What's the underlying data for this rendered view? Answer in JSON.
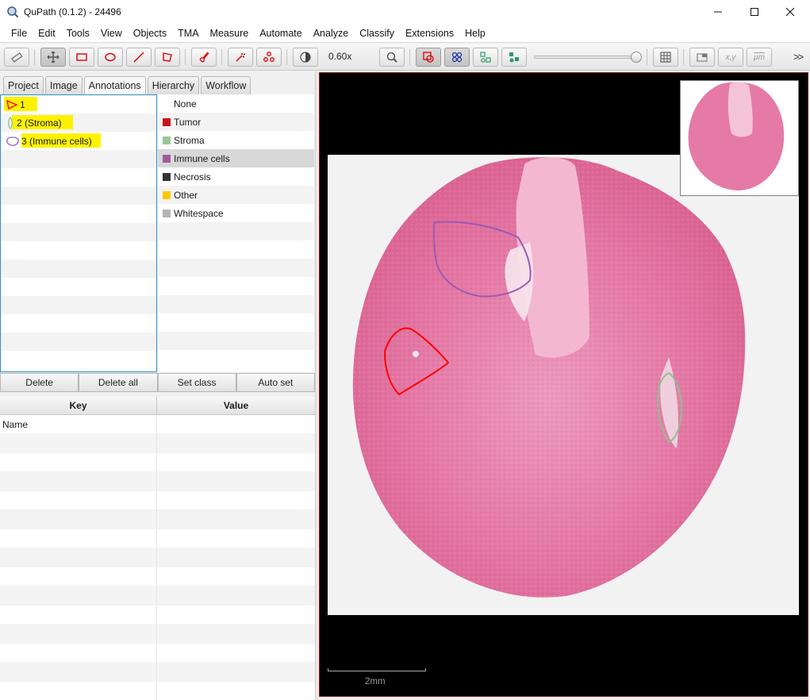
{
  "window": {
    "title": "QuPath (0.1.2) - 24496",
    "app_icon": "qupath-magnifier-icon",
    "controls": [
      "minimize-icon",
      "maximize-icon",
      "close-icon"
    ]
  },
  "menu": [
    "File",
    "Edit",
    "Tools",
    "View",
    "Objects",
    "TMA",
    "Measure",
    "Automate",
    "Analyze",
    "Classify",
    "Extensions",
    "Help"
  ],
  "toolbar": {
    "zoom_label": "0.60x",
    "coord_button": "x,y",
    "micron_button": "μm",
    "overflow": ">>",
    "active_tool": "move-tool",
    "icons": [
      "measurement-tool-icon",
      "move-icon",
      "rectangle-icon",
      "ellipse-icon",
      "line-icon",
      "polygon-icon",
      "brush-icon",
      "wand-icon",
      "points-icon",
      "brightness-contrast-icon",
      "zoom-to-fit-icon",
      "show-annotations-icon",
      "show-tma-grid-icon",
      "show-detections-icon",
      "fill-detections-icon",
      "opacity-slider",
      "grid-icon",
      "overview-icon",
      "location-icon",
      "scalebar-icon"
    ],
    "opacity_level": 0.95
  },
  "left_tabs": [
    "Project",
    "Image",
    "Annotations",
    "Hierarchy",
    "Workflow"
  ],
  "selected_tab": "Annotations",
  "annotations": [
    {
      "label": "1",
      "color": "#ff0000",
      "highlighted": true
    },
    {
      "label": "2 (Stroma)",
      "color": "#8fbf8f",
      "highlighted": true
    },
    {
      "label": "3 (Immune cells)",
      "color": "#9b59b6",
      "highlighted": true
    }
  ],
  "classes": [
    {
      "name": "None",
      "color": ""
    },
    {
      "name": "Tumor",
      "color": "#c8141e"
    },
    {
      "name": "Stroma",
      "color": "#96c896"
    },
    {
      "name": "Immune cells",
      "color": "#a05aa0"
    },
    {
      "name": "Necrosis",
      "color": "#323232"
    },
    {
      "name": "Other",
      "color": "#ffc800"
    },
    {
      "name": "Whitespace",
      "color": "#b4b4b4"
    }
  ],
  "selected_class": "Immune cells",
  "buttons": [
    "Delete",
    "Delete all",
    "Set class",
    "Auto set"
  ],
  "kv_table": {
    "headers": [
      "Key",
      "Value"
    ],
    "rows": [
      {
        "key": "Name",
        "value": ""
      }
    ]
  },
  "viewer": {
    "scalebar_label": "2mm",
    "colors": {
      "tissue": "#e57aa7",
      "background": "#000000",
      "slide": "#f2f2f2"
    }
  }
}
